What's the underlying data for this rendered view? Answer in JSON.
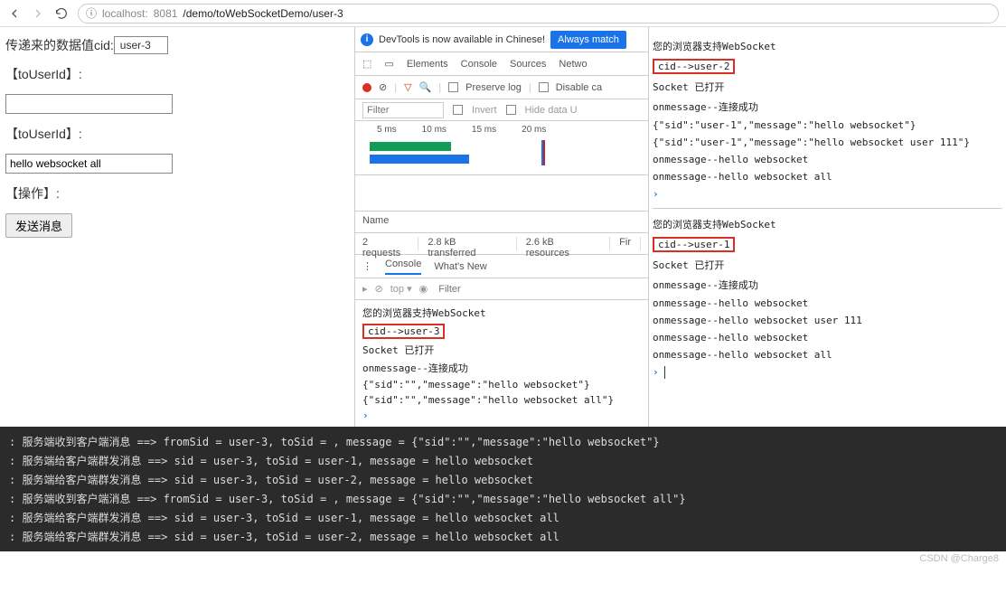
{
  "browser": {
    "url_prefix": "localhost:",
    "url_port": "8081",
    "url_path": "/demo/toWebSocketDemo/user-3"
  },
  "form": {
    "cid_label": "传递来的数据值cid:",
    "cid_value": "user-3",
    "toUserId1_label": "【toUserId】:",
    "toUserId1_value": "",
    "toUserId2_label": "【toUserId】:",
    "toUserId2_value": "hello websocket all",
    "action_label": "【操作】:",
    "send_btn": "发送消息"
  },
  "devtools": {
    "banner_text": "DevTools is now available in Chinese!",
    "always_btn": "Always match",
    "tabs": {
      "elements": "Elements",
      "console": "Console",
      "sources": "Sources",
      "network": "Netwo"
    },
    "toolbar": {
      "preserve": "Preserve log",
      "disable": "Disable ca"
    },
    "filter_placeholder": "Filter",
    "invert": "Invert",
    "hidedata": "Hide data U",
    "ticks": {
      "t1": "5 ms",
      "t2": "10 ms",
      "t3": "15 ms",
      "t4": "20 ms"
    },
    "name_header": "Name",
    "summary": {
      "requests": "2 requests",
      "transferred": "2.8 kB transferred",
      "resources": "2.6 kB resources",
      "finish": "Fir"
    },
    "console_tab": "Console",
    "whatsnew_tab": "What's New",
    "top_label": "top",
    "console_filter": "Filter",
    "lines": {
      "l1": "您的浏览器支持WebSocket",
      "l2": "cid-->user-3",
      "l3": "Socket 已打开",
      "l4": "onmessage--连接成功",
      "l5": "{\"sid\":\"\",\"message\":\"hello websocket\"}",
      "l6": "{\"sid\":\"\",\"message\":\"hello websocket all\"}"
    }
  },
  "right": {
    "block1": {
      "l1": "您的浏览器支持WebSocket",
      "l2": "cid-->user-2",
      "l3": "Socket 已打开",
      "l4": "onmessage--连接成功",
      "l5": "{\"sid\":\"user-1\",\"message\":\"hello websocket\"}",
      "l6": "{\"sid\":\"user-1\",\"message\":\"hello websocket user 111\"}",
      "l7": "onmessage--hello websocket",
      "l8": "onmessage--hello websocket all"
    },
    "block2": {
      "l1": "您的浏览器支持WebSocket",
      "l2": "cid-->user-1",
      "l3": "Socket 已打开",
      "l4": "onmessage--连接成功",
      "l5": "onmessage--hello websocket",
      "l6": "onmessage--hello websocket user 111",
      "l7": "onmessage--hello websocket",
      "l8": "onmessage--hello websocket all"
    }
  },
  "terminal": {
    "l1": ": 服务端收到客户端消息 ==> fromSid = user-3, toSid = , message = {\"sid\":\"\",\"message\":\"hello websocket\"}",
    "l2": ": 服务端给客户端群发消息 ==> sid = user-3, toSid = user-1, message = hello websocket",
    "l3": ": 服务端给客户端群发消息 ==> sid = user-3, toSid = user-2, message = hello websocket",
    "l4": ": 服务端收到客户端消息 ==> fromSid = user-3, toSid = , message = {\"sid\":\"\",\"message\":\"hello websocket all\"}",
    "l5": ": 服务端给客户端群发消息 ==> sid = user-3, toSid = user-1, message = hello websocket all",
    "l6": ": 服务端给客户端群发消息 ==> sid = user-3, toSid = user-2, message = hello websocket all"
  },
  "watermark": "CSDN @Charge8"
}
